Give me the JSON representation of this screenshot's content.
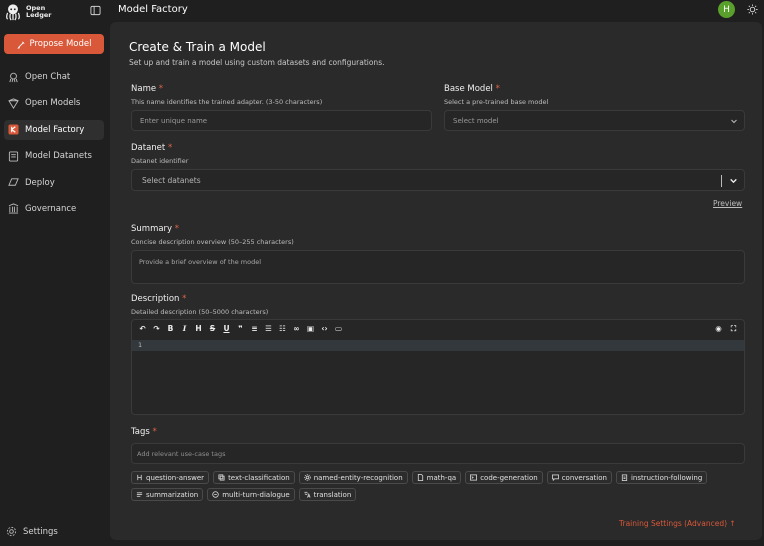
{
  "brand": {
    "name": "Open\nLedger"
  },
  "sidebar": {
    "propose_label": "Propose Model",
    "items": [
      {
        "label": "Open Chat",
        "icon": "chat-octopus-icon"
      },
      {
        "label": "Open Models",
        "icon": "models-icon"
      },
      {
        "label": "Model Factory",
        "icon": "factory-icon",
        "active": true
      },
      {
        "label": "Model Datanets",
        "icon": "datanet-icon"
      },
      {
        "label": "Deploy",
        "icon": "deploy-icon"
      },
      {
        "label": "Governance",
        "icon": "governance-icon"
      }
    ],
    "settings_label": "Settings"
  },
  "header": {
    "title": "Model Factory",
    "avatar_initial": "H"
  },
  "form": {
    "title": "Create & Train a Model",
    "subtitle": "Set up and train a model using custom datasets and configurations.",
    "name": {
      "label": "Name",
      "hint": "This name identifies the trained adapter. (3-50 characters)",
      "placeholder": "Enter unique name"
    },
    "base_model": {
      "label": "Base Model",
      "hint": "Select a pre-trained base model",
      "placeholder": "Select model"
    },
    "datanet": {
      "label": "Datanet",
      "hint": "Datanet identifier",
      "placeholder": "Select datanets"
    },
    "preview_label": "Preview",
    "summary": {
      "label": "Summary",
      "hint": "Concise description overview (50–255 characters)",
      "placeholder": "Provide a brief overview of the model"
    },
    "description": {
      "label": "Description",
      "hint": "Detailed description (50–5000 characters)",
      "line_number": "1"
    },
    "tags": {
      "label": "Tags",
      "placeholder": "Add relevant use-case tags",
      "items": [
        "question-answer",
        "text-classification",
        "named-entity-recognition",
        "math-qa",
        "code-generation",
        "conversation",
        "instruction-following",
        "summarization",
        "multi-turn-dialogue",
        "translation"
      ]
    },
    "training_settings_label": "Training Settings (Advanced)",
    "required_mark": "*"
  },
  "colors": {
    "accent": "#d9583a",
    "avatar": "#5aa02c"
  }
}
